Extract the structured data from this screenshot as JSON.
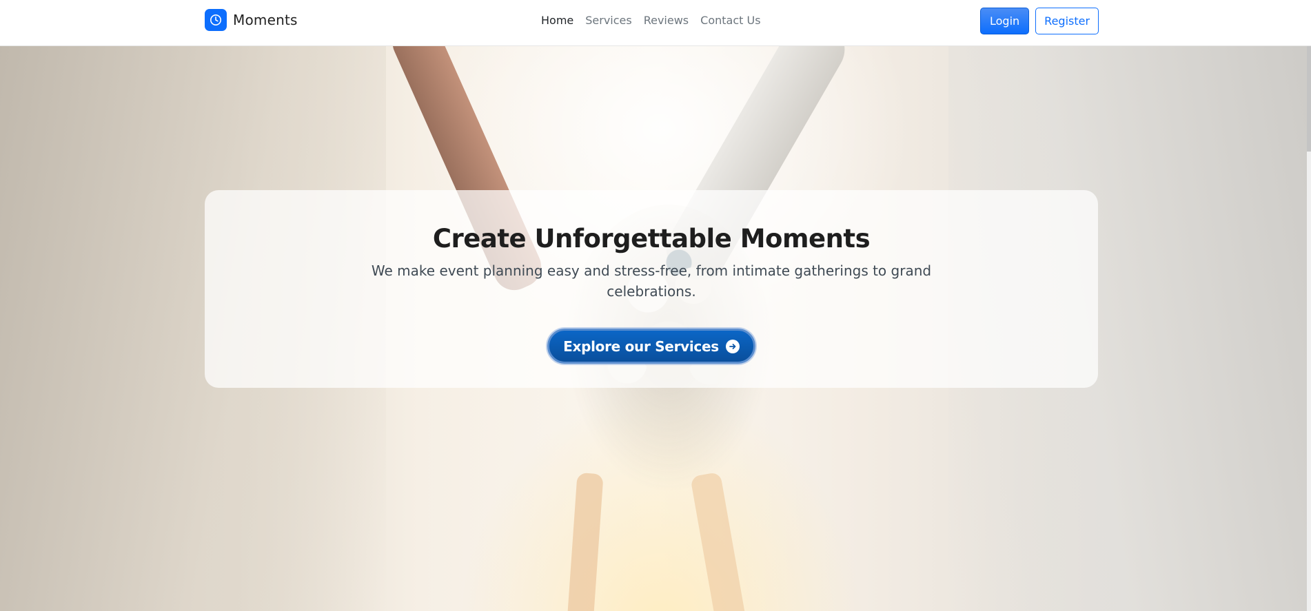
{
  "brand": {
    "name": "Moments",
    "logo_icon": "clock-icon",
    "accent": "#0d6efd"
  },
  "nav": {
    "items": [
      {
        "label": "Home",
        "active": true
      },
      {
        "label": "Services",
        "active": false
      },
      {
        "label": "Reviews",
        "active": false
      },
      {
        "label": "Contact Us",
        "active": false
      }
    ]
  },
  "auth": {
    "login_label": "Login",
    "register_label": "Register"
  },
  "hero": {
    "title": "Create Unforgettable Moments",
    "subtitle": "We make event planning easy and stress-free, from intimate gatherings to grand celebrations.",
    "cta_label": "Explore our Services",
    "cta_icon": "arrow-right-circle-icon"
  }
}
